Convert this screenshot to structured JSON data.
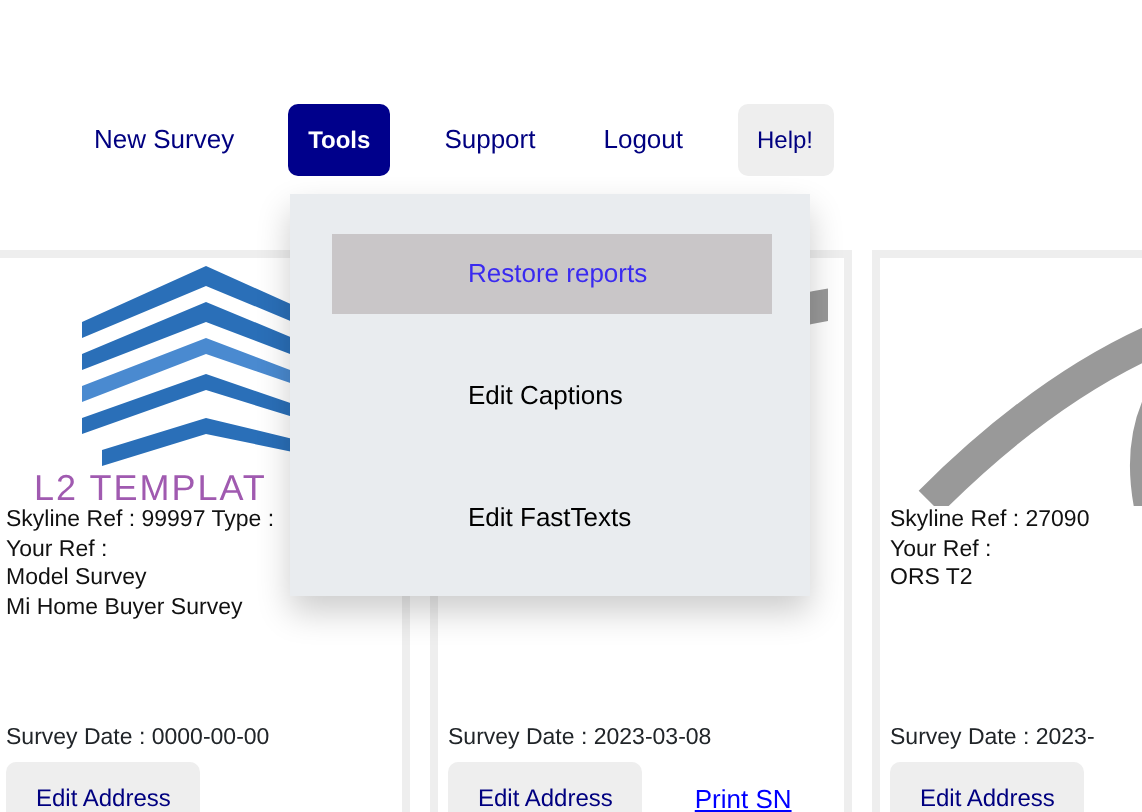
{
  "nav": [
    {
      "label": "New Survey",
      "kind": "link",
      "selected": false
    },
    {
      "label": "Tools",
      "kind": "button",
      "selected": true
    },
    {
      "label": "Support",
      "kind": "link",
      "selected": false
    },
    {
      "label": "Logout",
      "kind": "link",
      "selected": false
    },
    {
      "label": "Help!",
      "kind": "button",
      "selected": false
    }
  ],
  "tools_menu": {
    "items": [
      {
        "label": "Restore reports",
        "selected": true
      },
      {
        "label": "Edit Captions",
        "selected": false
      },
      {
        "label": "Edit FastTexts",
        "selected": false
      }
    ]
  },
  "cards": [
    {
      "kind": "logo",
      "logo_text": "L2 TEMPLAT",
      "lines": [
        "Skyline Ref : 99997 Type :",
        "Your Ref :",
        "Model Survey",
        "Mi Home Buyer Survey"
      ],
      "survey_date": "Survey Date : 0000-00-00",
      "actions": [
        {
          "label": "Edit Address",
          "kind": "button"
        }
      ]
    },
    {
      "kind": "eye",
      "survey_date": "Survey Date : 2023-03-08",
      "actions": [
        {
          "label": "Edit Address",
          "kind": "button"
        },
        {
          "label": "Print SN",
          "kind": "link"
        }
      ]
    },
    {
      "kind": "eye",
      "lines": [
        "Skyline Ref : 27090",
        "Your Ref :",
        "ORS T2"
      ],
      "survey_date": "Survey Date : 2023-",
      "actions": [
        {
          "label": "Edit Address",
          "kind": "button"
        }
      ]
    }
  ]
}
